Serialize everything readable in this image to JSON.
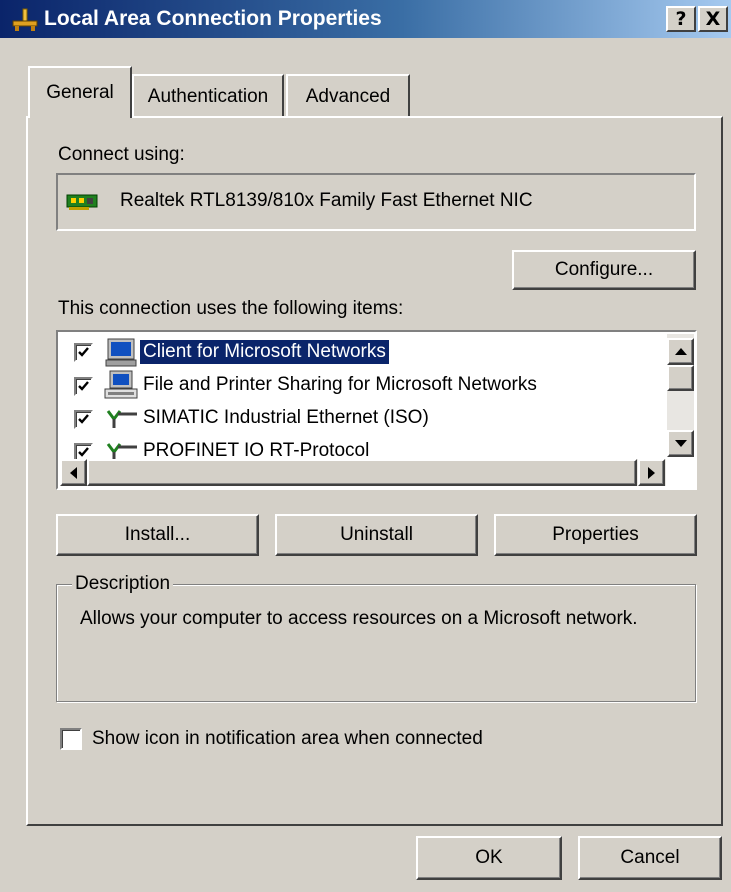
{
  "window": {
    "title": "Local Area Connection Properties",
    "help_label": "?",
    "close_label": "X"
  },
  "tabs": [
    {
      "label": "General",
      "selected": true
    },
    {
      "label": "Authentication",
      "selected": false
    },
    {
      "label": "Advanced",
      "selected": false
    }
  ],
  "general": {
    "connect_using_label": "Connect using:",
    "adapter_name": "Realtek RTL8139/810x Family Fast Ethernet NIC",
    "configure_label": "Configure...",
    "items_label": "This connection uses the following items:",
    "items": [
      {
        "label": "Client for Microsoft Networks",
        "checked": true,
        "selected": true,
        "icon": "network-client-icon"
      },
      {
        "label": "File and Printer Sharing for Microsoft Networks",
        "checked": true,
        "selected": false,
        "icon": "file-printer-sharing-icon"
      },
      {
        "label": "SIMATIC Industrial Ethernet (ISO)",
        "checked": true,
        "selected": false,
        "icon": "protocol-icon"
      },
      {
        "label": "PROFINET IO RT-Protocol",
        "checked": true,
        "selected": false,
        "icon": "protocol-icon"
      }
    ],
    "install_label": "Install...",
    "uninstall_label": "Uninstall",
    "properties_label": "Properties",
    "description_legend": "Description",
    "description_text": "Allows your computer to access resources on a Microsoft network.",
    "show_icon_label": "Show icon in notification area when connected",
    "show_icon_checked": false
  },
  "footer": {
    "ok_label": "OK",
    "cancel_label": "Cancel"
  },
  "colors": {
    "face": "#d4d0c8",
    "title_start": "#0a246a",
    "title_end": "#a6caf0",
    "selection": "#0a246a"
  }
}
